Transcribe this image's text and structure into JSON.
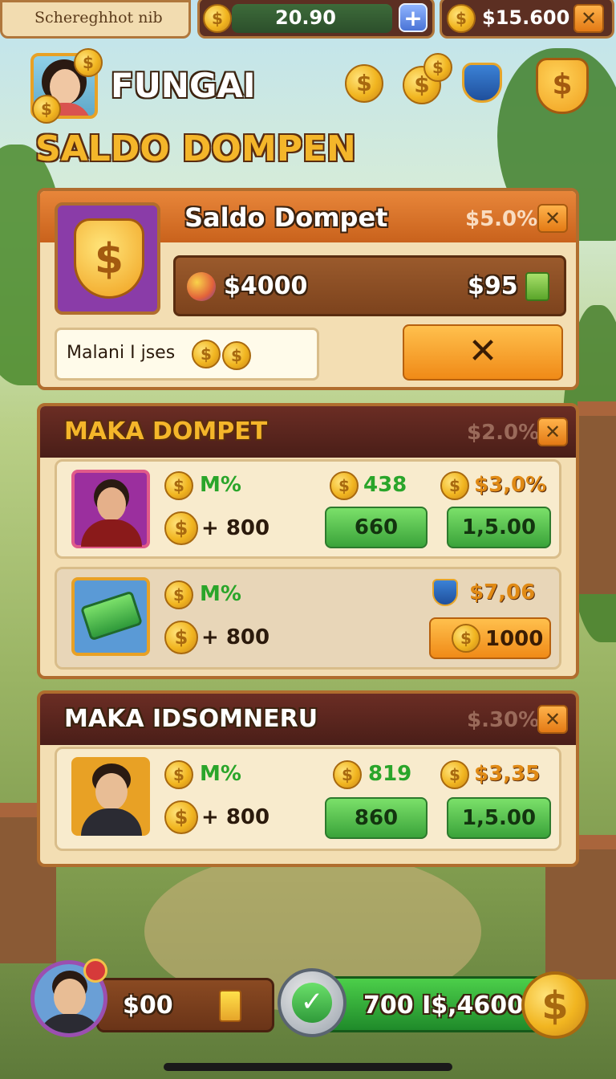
{
  "top_bar": {
    "player_name": "Schereghhot nib",
    "energy_value": "20.90",
    "plus_label": "+",
    "cash_value": "$15.600",
    "close_label": "✕"
  },
  "header": {
    "name": "FUNGAI",
    "subtitle": "SALDO DOMPEN"
  },
  "wallet_panel": {
    "title": "Saldo Dompet",
    "percent": "$5.0%",
    "close_label": "✕",
    "balance": "$4000",
    "amount": "$95",
    "input_text": "Malani I jses",
    "confirm_label": "✕"
  },
  "maka_dompet": {
    "title": "MAKA DOMPET",
    "percent": "$2.0%",
    "close_label": "✕",
    "row1": {
      "stat1": "M%",
      "stat2": "+ 800",
      "col1_value": "438",
      "col2_value": "$3,0%",
      "btn1": "660",
      "btn2": "1,5.00"
    },
    "row2": {
      "stat1": "M%",
      "stat2": "+ 800",
      "price": "$7,06",
      "btn": "1000"
    }
  },
  "maka_idsomneru": {
    "title": "MAKA IDSOMNERU",
    "percent": "$.30%",
    "close_label": "✕",
    "row1": {
      "stat1": "M%",
      "stat2": "+ 800",
      "col1_value": "819",
      "col2_value": "$3,35",
      "btn1": "860",
      "btn2": "1,5.00"
    }
  },
  "bottom_bar": {
    "balance": "$00",
    "collect_value": "700 I$,4600",
    "coin_symbol": "$"
  },
  "icons": [
    "coin-icon",
    "plus-icon",
    "close-icon",
    "shield-icon",
    "gift-shield-icon",
    "money-bag-icon",
    "cash-bill-icon",
    "check-arrow-icon",
    "trophy-icon"
  ]
}
